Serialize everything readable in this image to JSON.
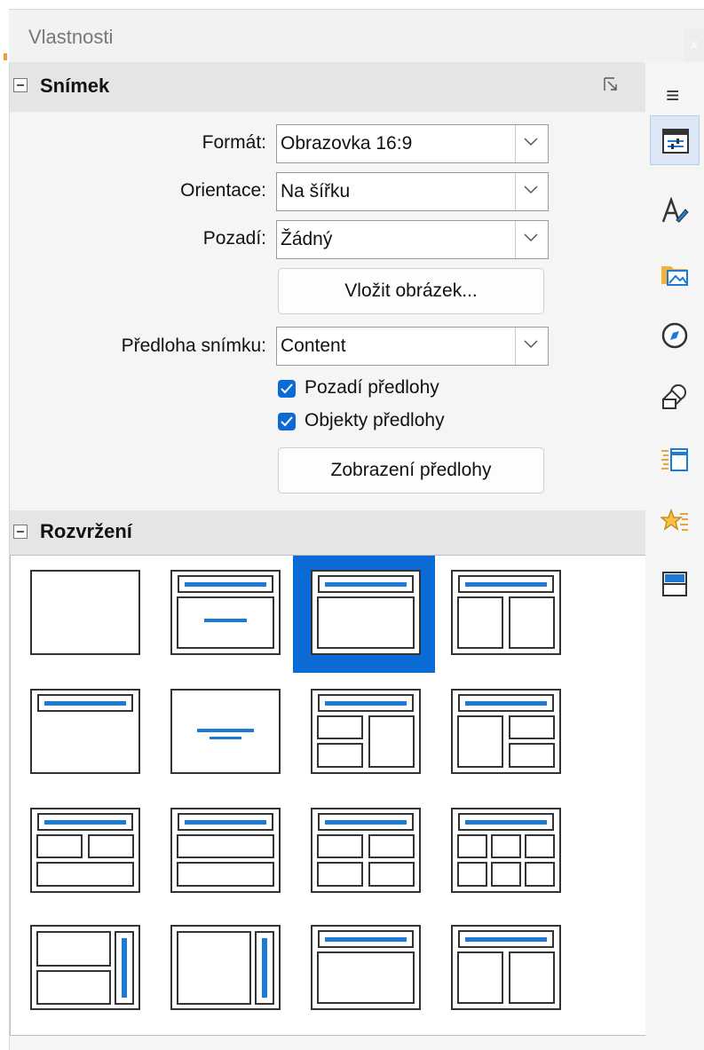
{
  "window": {
    "title": "Vlastnosti",
    "close_label": "x"
  },
  "slide_section": {
    "title": "Snímek",
    "format_label": "Formát:",
    "format_value": "Obrazovka 16:9",
    "orientation_label": "Orientace:",
    "orientation_value": "Na šířku",
    "background_label": "Pozadí:",
    "background_value": "Žádný",
    "insert_image_label": "Vložit obrázek...",
    "master_label": "Předloha snímku:",
    "master_value": "Content",
    "master_background_label": "Pozadí předlohy",
    "master_objects_label": "Objekty předlohy",
    "master_view_label": "Zobrazení předlohy"
  },
  "layout_section": {
    "title": "Rozvržení",
    "selected_index": 2
  },
  "sidebar": {
    "menu_icon": "hamburger-icon",
    "tabs": [
      "properties-icon",
      "styles-icon",
      "gallery-icon",
      "navigator-icon",
      "shapes-icon",
      "slide-transition-icon",
      "animation-icon",
      "master-slides-icon"
    ]
  },
  "colors": {
    "accent": "#0a6bd6",
    "panel": "#f5f5f5",
    "header": "#e5e5e5"
  }
}
